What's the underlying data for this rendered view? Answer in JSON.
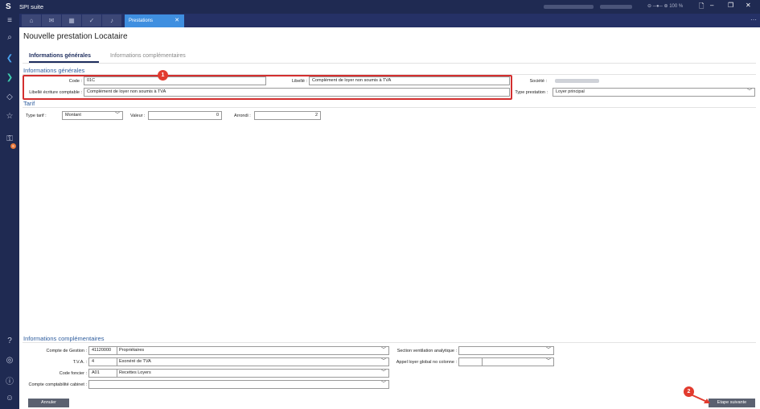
{
  "window": {
    "app_title": "SPI suite",
    "zoom_text": "100 %",
    "icons": [
      "logo-icon",
      "slider-icon",
      "document-icon",
      "minimize-icon",
      "restore-icon",
      "close-icon"
    ]
  },
  "tabs": {
    "icon_tabs": [
      "home-icon",
      "mail-icon",
      "calendar-icon",
      "check-icon",
      "bell-icon"
    ],
    "active_label": "Prestations",
    "close_glyph": "✕",
    "more_glyph": "⋯"
  },
  "rail": {
    "icons": [
      "hamburger-icon",
      "search-icon",
      "collapse-left-icon",
      "expand-right-icon",
      "code-icon",
      "star-icon",
      "notification-icon",
      "help-icon",
      "support-icon",
      "info-icon",
      "user-icon"
    ],
    "badge": "6"
  },
  "page": {
    "title": "Nouvelle prestation Locataire",
    "tab_general": "Informations générales",
    "tab_complementary": "Informations complémentaires"
  },
  "general": {
    "section_title": "Informations générales",
    "code_label": "Code :",
    "code_value": "01C",
    "libelle_label": "Libellé :",
    "libelle_value": "Complément de loyer non soumis à TVA",
    "societe_label": "Société :",
    "libelle_ecriture_label": "Libellé écriture comptable :",
    "libelle_ecriture_value": "Complément de loyer non soumis à TVA",
    "type_prestation_label": "Type prestation :",
    "type_prestation_value": "Loyer principal"
  },
  "tarif": {
    "section_title": "Tarif",
    "type_label": "Type tarif :",
    "type_value": "Montant",
    "valeur_label": "Valeur :",
    "valeur_value": "0",
    "arrondi_label": "Arrondi :",
    "arrondi_value": "2"
  },
  "complementary": {
    "section_title": "Informations complémentaires",
    "compte_gestion_label": "Compte de Gestion :",
    "compte_gestion_code": "41120000",
    "compte_gestion_name": "Propriétaires",
    "tva_label": "T.V.A. :",
    "tva_code": "4",
    "tva_name": "Exonéré de TVA",
    "code_foncier_label": "Code foncier :",
    "code_foncier_code": "A01",
    "code_foncier_name": "Recettes Loyers",
    "compte_cabinet_label": "Compte comptabilité cabinet :",
    "section_ventilation_label": "Section ventilation analytique :",
    "appel_loyer_label": "Appel loyer global no colonne :"
  },
  "footer": {
    "cancel_label": "Annuler",
    "next_label": "Etape suivante"
  },
  "annotations": {
    "marker1": "1",
    "marker2": "2",
    "highlight_color": "#d32f2f"
  }
}
